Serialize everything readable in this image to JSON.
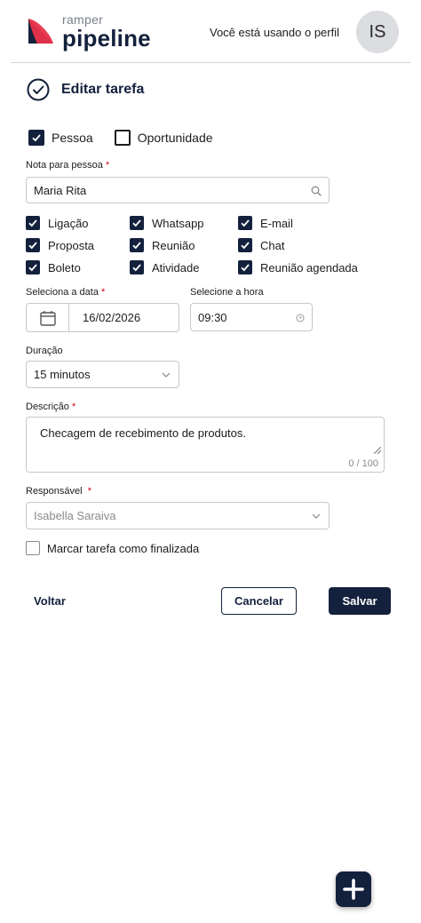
{
  "header": {
    "logo_small": "ramper",
    "logo_big": "pipeline",
    "profile_text": "Você está usando o perfil",
    "avatar_initials": "IS"
  },
  "title": "Editar tarefa",
  "type_options": {
    "person": {
      "label": "Pessoa",
      "checked": true
    },
    "opportunity": {
      "label": "Oportunidade",
      "checked": false
    }
  },
  "note_field": {
    "label": "Nota para pessoa",
    "required_mark": "*",
    "value": "Maria Rita"
  },
  "channels": [
    {
      "label": "Ligação",
      "checked": true
    },
    {
      "label": "Whatsapp",
      "checked": true
    },
    {
      "label": "E-mail",
      "checked": true
    },
    {
      "label": "Proposta",
      "checked": true
    },
    {
      "label": "Reunião",
      "checked": true
    },
    {
      "label": "Chat",
      "checked": true
    },
    {
      "label": "Boleto",
      "checked": true
    },
    {
      "label": "Atividade",
      "checked": true
    },
    {
      "label": "Reunião agendada",
      "checked": true
    }
  ],
  "date_field": {
    "label": "Seleciona a data",
    "required_mark": "*",
    "value": "16/02/2026"
  },
  "time_field": {
    "label": "Selecione a hora",
    "value": "09:30"
  },
  "duration_field": {
    "label": "Duração",
    "value": "15 minutos"
  },
  "description_field": {
    "label": "Descrição",
    "required_mark": "*",
    "value": "Checagem de recebimento de produtos.",
    "counter": "0 / 100"
  },
  "responsible_field": {
    "label": "Responsável",
    "required_mark": "*",
    "value": "Isabella Saraiva"
  },
  "finish_checkbox": {
    "label": "Marcar tarefa como finalizada",
    "checked": false
  },
  "actions": {
    "back": "Voltar",
    "cancel": "Cancelar",
    "save": "Salvar"
  },
  "colors": {
    "primary": "#14213d",
    "required": "#d0021b",
    "logo_red": "#e8334a"
  }
}
